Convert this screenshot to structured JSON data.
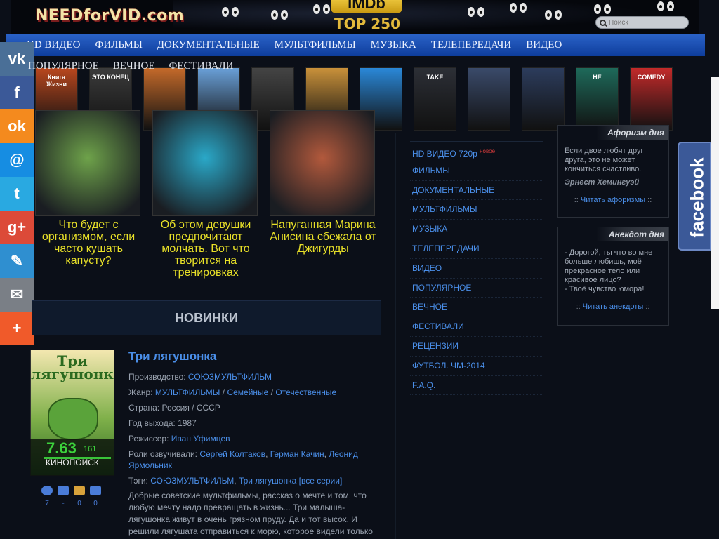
{
  "header": {
    "logo": "NEEDforVID.com",
    "imdb_label": "IMDb",
    "imdb_sub": "TOP 250",
    "search_placeholder": "Поиск"
  },
  "nav": {
    "items": [
      "HD ВИДЕО",
      "ФИЛЬМЫ",
      "ДОКУМЕНТАЛЬНЫЕ",
      "МУЛЬТФИЛЬМЫ",
      "МУЗЫКА",
      "ТЕЛЕПЕРЕДАЧИ",
      "ВИДЕО"
    ],
    "second_row": [
      "ПОПУЛЯРНОЕ",
      "ВЕЧНОЕ",
      "ФЕСТИВАЛИ"
    ]
  },
  "posters": [
    {
      "label": "Книга Жизни",
      "color": "#b8471e"
    },
    {
      "label": "ЭТО КОНЕЦ",
      "color": "#3b3b3b"
    },
    {
      "label": "",
      "color": "#c46a2a"
    },
    {
      "label": "",
      "color": "#6aa0d8"
    },
    {
      "label": "",
      "color": "#444"
    },
    {
      "label": "",
      "color": "#c9913a"
    },
    {
      "label": "",
      "color": "#2a88d8"
    },
    {
      "label": "TAKE",
      "color": "#2c2f36"
    },
    {
      "label": "",
      "color": "#3a4a6a"
    },
    {
      "label": "",
      "color": "#2c3c5c"
    },
    {
      "label": "НЕ",
      "color": "#1e6a5a"
    },
    {
      "label": "COMEDY",
      "color": "#c22a2a"
    }
  ],
  "share": [
    {
      "name": "vk",
      "glyph": "vk",
      "color": "#4a6f97"
    },
    {
      "name": "facebook",
      "glyph": "f",
      "color": "#3b5998"
    },
    {
      "name": "odnoklassniki",
      "glyph": "ok",
      "color": "#f48a1e"
    },
    {
      "name": "mailru",
      "glyph": "@",
      "color": "#168de2"
    },
    {
      "name": "twitter",
      "glyph": "t",
      "color": "#29a9e1"
    },
    {
      "name": "googleplus",
      "glyph": "g+",
      "color": "#dc4a38"
    },
    {
      "name": "livejournal",
      "glyph": "✎",
      "color": "#2f8fd0"
    },
    {
      "name": "email",
      "glyph": "✉",
      "color": "#7a7f86"
    },
    {
      "name": "more",
      "glyph": "+",
      "color": "#f05a2a"
    }
  ],
  "teasers": [
    {
      "caption": "Что будет с организмом, если часто кушать капусту?",
      "color": "#6ea24a"
    },
    {
      "caption": "Об этом девушки предпочитают молчать. Вот что творится на тренировках",
      "color": "#2aa8c8"
    },
    {
      "caption": "Напуганная Марина Анисина сбежала от Джигурды",
      "color": "#b2593c"
    }
  ],
  "section_title": "НОВИНКИ",
  "movie": {
    "title": "Три лягушонка",
    "cover_title_line1": "Три",
    "cover_title_line2": "лягушонка",
    "production_label": "Производство:",
    "production": "СОЮЗМУЛЬТФИЛЬМ",
    "genre_label": "Жанр:",
    "genres": [
      "МУЛЬТФИЛЬМЫ",
      "Семейные",
      "Отечественные"
    ],
    "country_label": "Страна:",
    "country": "Россия / СССР",
    "year_label": "Год выхода:",
    "year": "1987",
    "director_label": "Режиссер:",
    "director": "Иван Уфимцев",
    "voices_label": "Роли озвучивали:",
    "voices": [
      "Сергей Колтаков",
      "Герман Качин",
      "Леонид Ярмольник"
    ],
    "tags_label": "Тэги:",
    "tags": [
      "СОЮЗМУЛЬТФИЛЬМ",
      "Три лягушонка [все серии]"
    ],
    "description": "Добрые советские мультфильмы, рассказ о мечте и том, что любую мечту надо превращать в жизнь... Три малыша-лягушонка живут в очень грязном пруду. Да и тот высох. И решили лягушата отправиться к морю, которое видели только",
    "kp_score": "7.63",
    "kp_votes": "161",
    "kp_name": "КИНОПОИСК",
    "stats": [
      {
        "icon": "eye-icon",
        "value": "7"
      },
      {
        "icon": "rating-bars-icon",
        "value": "-"
      },
      {
        "icon": "favorite-icon",
        "value": "0"
      },
      {
        "icon": "comment-icon",
        "value": "0"
      }
    ]
  },
  "sidebar": {
    "items": [
      "HD ВИДЕО 720p",
      "ФИЛЬМЫ",
      "ДОКУМЕНТАЛЬНЫЕ",
      "МУЛЬТФИЛЬМЫ",
      "МУЗЫКА",
      "ТЕЛЕПЕРЕДАЧИ",
      "ВИДЕО",
      "ПОПУЛЯРНОЕ",
      "ВЕЧНОЕ",
      "ФЕСТИВАЛИ",
      "РЕЦЕНЗИИ",
      "ФУТБОЛ. ЧМ-2014",
      "F.A.Q."
    ],
    "new_badge": "новое"
  },
  "aphorism": {
    "header": "Афоризм дня",
    "text": "Если двое любят друг друга, это не может кончиться счастливо.",
    "author": "Эрнест Хемингуэй",
    "link": "Читать афоризмы"
  },
  "joke": {
    "header": "Анекдот дня",
    "text1": "- Дорогой, ты что во мне больше любишь, моё прекрасное тело или красивое лицо?",
    "text2": "- Твоё чувство юмора!",
    "link": "Читать анекдоты"
  },
  "facebook_label": "facebook"
}
